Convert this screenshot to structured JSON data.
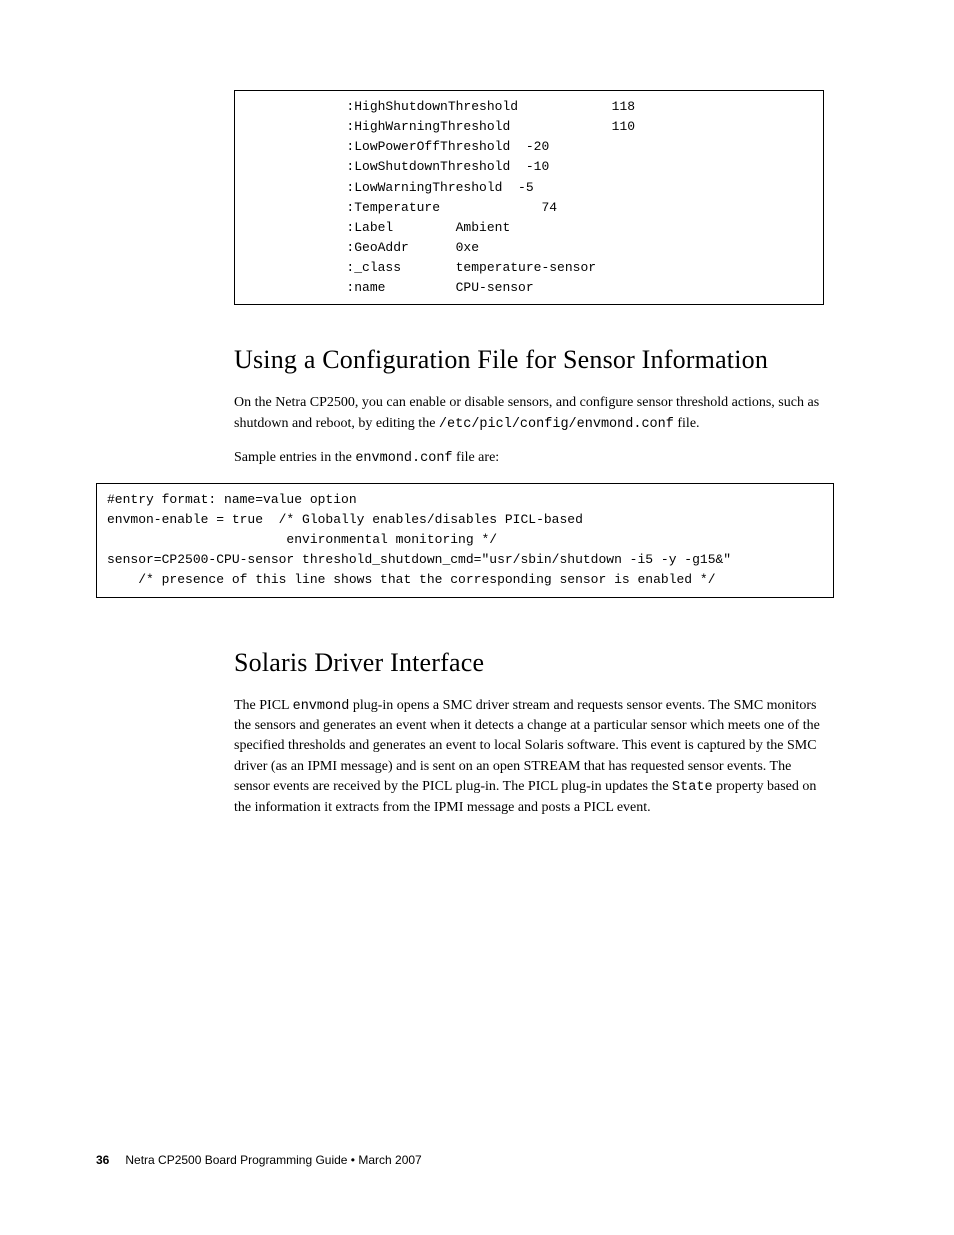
{
  "code_table": {
    "rows": [
      {
        "key": ":HighShutdownThreshold",
        "val": "118",
        "valcol": 34
      },
      {
        "key": ":HighWarningThreshold",
        "val": "110",
        "valcol": 34
      },
      {
        "key": ":LowPowerOffThreshold",
        "val": "-20",
        "valcol": 23
      },
      {
        "key": ":LowShutdownThreshold",
        "val": "-10",
        "valcol": 23
      },
      {
        "key": ":LowWarningThreshold",
        "val": "-5",
        "valcol": 22
      },
      {
        "key": ":Temperature",
        "val": "74",
        "valcol": 25
      },
      {
        "key": ":Label",
        "val": "Ambient",
        "valcol": 14
      },
      {
        "key": ":GeoAddr",
        "val": "0xe",
        "valcol": 14
      },
      {
        "key": ":_class",
        "val": "temperature-sensor",
        "valcol": 14
      },
      {
        "key": ":name",
        "val": "CPU-sensor",
        "valcol": 14
      }
    ]
  },
  "section1": {
    "heading": "Using a Configuration File for Sensor Information",
    "p1_a": "On the Netra CP2500, you can enable or disable sensors, and configure sensor threshold actions, such as shutdown and reboot, by editing the ",
    "p1_code": "/etc/picl/config/envmond.conf",
    "p1_b": " file.",
    "p2_a": "Sample entries in the ",
    "p2_code": "envmond.conf",
    "p2_b": " file are:"
  },
  "code_block2": "#entry format: name=value option\nenvmon-enable = true  /* Globally enables/disables PICL-based\n                       environmental monitoring */\nsensor=CP2500-CPU-sensor threshold_shutdown_cmd=\"usr/sbin/shutdown -i5 -y -g15&\"\n    /* presence of this line shows that the corresponding sensor is enabled */",
  "section2": {
    "heading": "Solaris Driver Interface",
    "p1_a": "The PICL ",
    "p1_code": "envmond",
    "p1_b": " plug-in opens a SMC driver stream and requests sensor events. The SMC monitors the sensors and generates an event when it detects a change at a particular sensor which meets one of the specified thresholds and generates an event to local Solaris software. This event is captured by the SMC driver (as an IPMI message) and is sent on an open STREAM that has requested sensor events. The sensor events are received by the PICL plug-in. The PICL plug-in updates the ",
    "p1_code2": "State",
    "p1_c": " property based on the information it extracts from the IPMI message and posts a PICL event."
  },
  "footer": {
    "page": "36",
    "text": "Netra CP2500 Board Programming Guide  •  March 2007"
  }
}
